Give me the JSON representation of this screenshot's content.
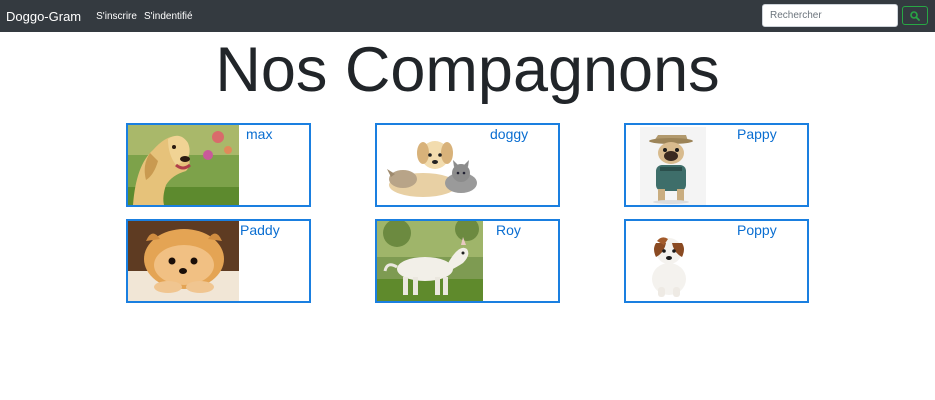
{
  "navbar": {
    "brand": "Doggo-Gram",
    "links": [
      "S'inscrire",
      "S'indentifié"
    ],
    "search": {
      "placeholder": "Rechercher",
      "value": ""
    },
    "search_button_icon": "search-icon"
  },
  "page": {
    "title": "Nos Compagnons"
  },
  "dogs": [
    {
      "name": "max",
      "image": "golden-retriever-photo"
    },
    {
      "name": "doggy",
      "image": "puppy-and-kitten-photo"
    },
    {
      "name": "Pappy",
      "image": "pug-in-hat-photo"
    },
    {
      "name": "Paddy",
      "image": "pomeranian-photo"
    },
    {
      "name": "Roy",
      "image": "bull-terrier-photo"
    },
    {
      "name": "Poppy",
      "image": "jack-russell-puppy-photo"
    }
  ],
  "colors": {
    "navbar": "#343a40",
    "card_border": "#1a7fe0",
    "link": "#0a6ed1",
    "search_button": "#28a745"
  }
}
